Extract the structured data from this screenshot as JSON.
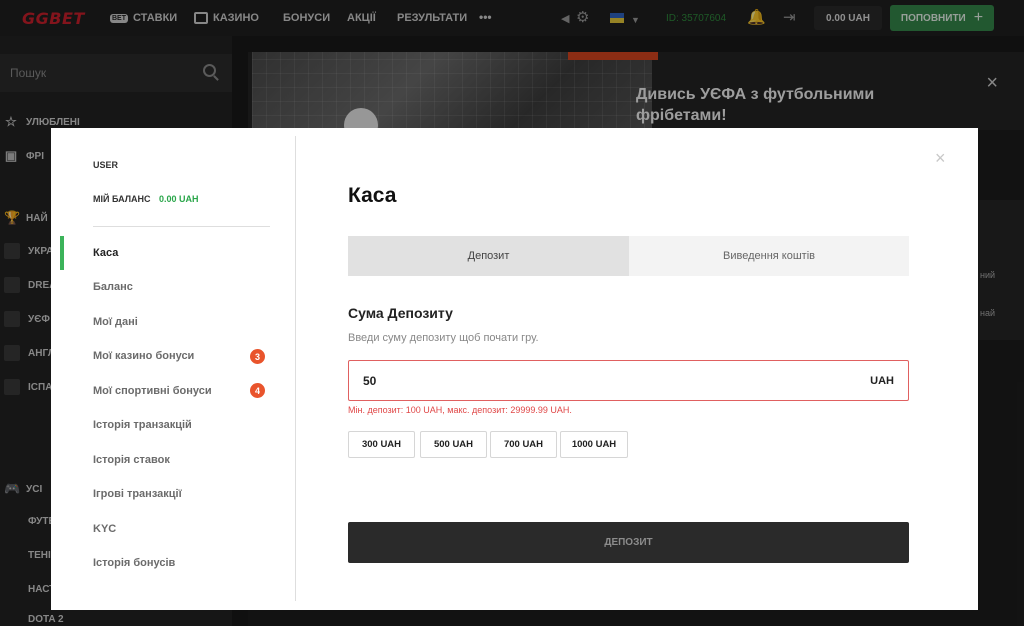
{
  "topbar": {
    "logo": "GGBET",
    "nav": [
      {
        "label": "СТАВКИ",
        "icon": "bet-badge-icon",
        "badge": "BET"
      },
      {
        "label": "КАЗИНО",
        "icon": "cards-icon"
      },
      {
        "label": "БОНУСИ"
      },
      {
        "label": "АКЦІЇ"
      },
      {
        "label": "РЕЗУЛЬТАТИ"
      }
    ],
    "more": "•••",
    "user_id": "ID: 35707604",
    "balance": "0.00 UAH",
    "topup_label": "ПОПОВНИТИ"
  },
  "sidebar": {
    "search_placeholder": "Пошук",
    "favorites": "УЛЮБЛЕНІ",
    "freebets": "ФРІ",
    "popular": "НАЙ",
    "leagues": [
      "Укра",
      "Drea",
      "УЄФ",
      "Англ",
      "Іспа"
    ],
    "all_sports": "УСІ",
    "sports": [
      "Футб",
      "Тені",
      "Наст",
      "Dota 2"
    ]
  },
  "banner": {
    "line1": "Дивись УЄФА з футбольними",
    "line2": "фрібетами!",
    "close": "×"
  },
  "right_card": {
    "line1": "ний",
    "line2": "най"
  },
  "modal": {
    "close": "×",
    "user_label": "USER",
    "balance_label": "МІЙ БАЛАНС",
    "balance_value": "0.00 UAH",
    "menu": [
      {
        "label": "Каса",
        "active": true
      },
      {
        "label": "Баланс"
      },
      {
        "label": "Мої дані"
      },
      {
        "label": "Мої казино бонуси",
        "badge": "3"
      },
      {
        "label": "Мої спортивні бонуси",
        "badge": "4"
      },
      {
        "label": "Історія транзакцій"
      },
      {
        "label": "Історія ставок"
      },
      {
        "label": "Ігрові транзакції"
      },
      {
        "label": "KYC"
      },
      {
        "label": "Історія бонусів"
      }
    ],
    "title": "Каса",
    "tabs": [
      {
        "label": "Депозит",
        "active": true
      },
      {
        "label": "Виведення коштів",
        "active": false
      }
    ],
    "section_title": "Сума Депозиту",
    "hint": "Введи суму депозиту щоб почати гру.",
    "amount": {
      "value": "50",
      "currency": "UAH"
    },
    "error": "Мін. депозит: 100 UAH, макс. депозит: 29999.99 UAH.",
    "quick_amounts": [
      "300 UAH",
      "500 UAH",
      "700 UAH",
      "1000 UAH"
    ],
    "submit_label": "ДЕПОЗИТ"
  },
  "colors": {
    "accent_green": "#3cb35a",
    "balance_green": "#2aa64a",
    "error_red": "#e04848",
    "badge_orange": "#e9542c",
    "submit_dark": "#2a2a2a"
  }
}
